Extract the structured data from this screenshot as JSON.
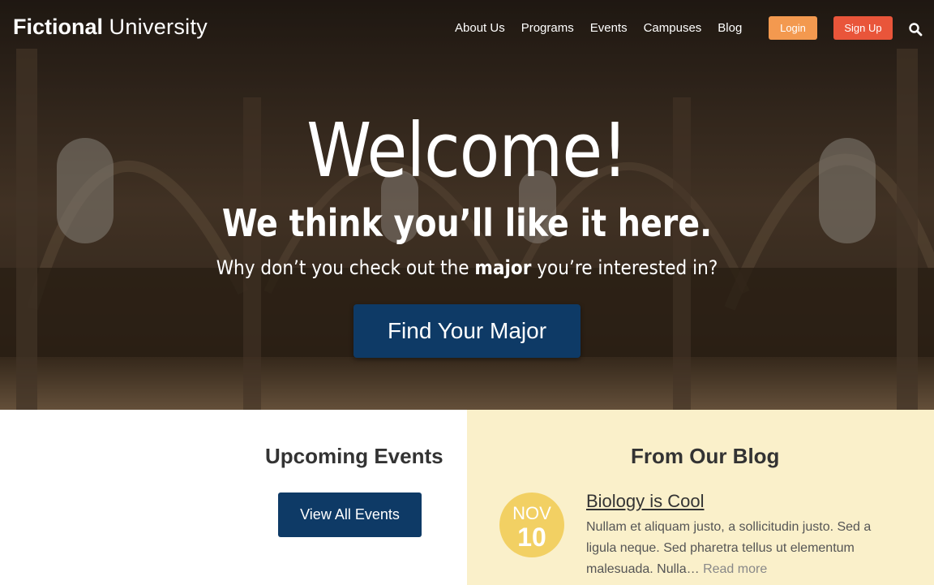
{
  "header": {
    "logo_bold": "Fictional",
    "logo_light": "University",
    "nav": [
      "About Us",
      "Programs",
      "Events",
      "Campuses",
      "Blog"
    ],
    "login_label": "Login",
    "signup_label": "Sign Up",
    "search_icon": "search-icon"
  },
  "hero": {
    "title": "Welcome!",
    "subtitle": "We think you’ll like it here.",
    "text_before": "Why don’t you check out the ",
    "text_bold": "major",
    "text_after": " you’re interested in?",
    "button_label": "Find Your Major"
  },
  "events": {
    "title": "Upcoming Events",
    "button_label": "View All Events"
  },
  "blog": {
    "title": "From Our Blog",
    "post": {
      "month": "NOV",
      "day": "10",
      "title": "Biology is Cool",
      "excerpt": "Nullam et aliquam justo, a sollicitudin justo. Sed a ligula neque. Sed pharetra tellus ut elementum malesuada. Nulla…",
      "read_more": "Read more"
    }
  },
  "colors": {
    "primary": "#0e3a66",
    "login": "#f3994f",
    "signup": "#e9553a",
    "blog_bg": "#faf0ca",
    "date_circle": "#f2d063"
  }
}
